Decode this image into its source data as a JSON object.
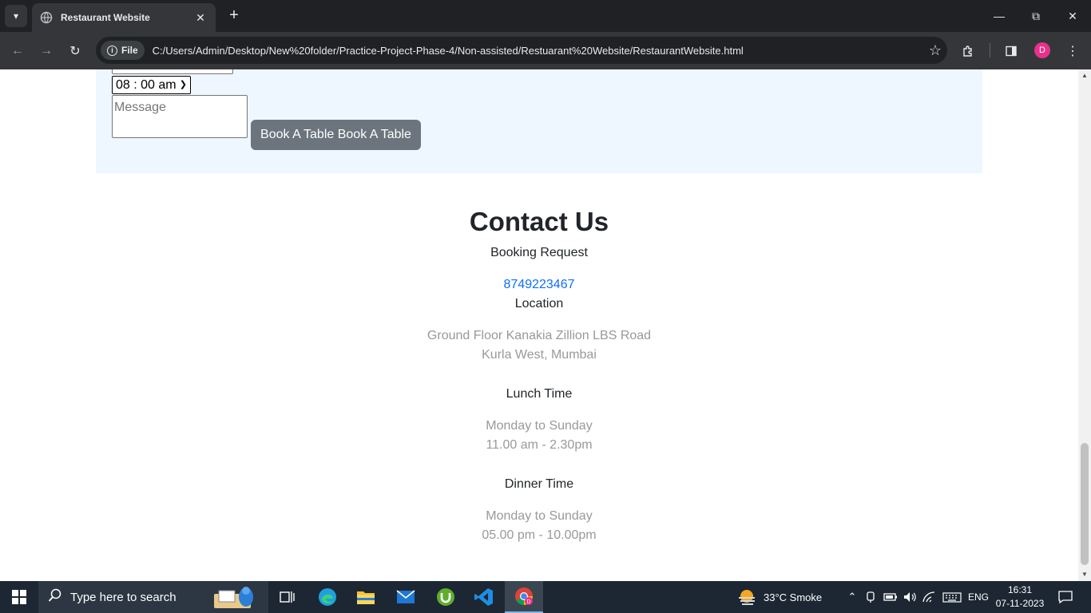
{
  "browser": {
    "tab_title": "Restaurant Website",
    "file_chip": "File",
    "url": "C:/Users/Admin/Desktop/New%20folder/Practice-Project-Phase-4/Non-assisted/Restuarant%20Website/RestaurantWebsite.html",
    "profile_initial": "D"
  },
  "booking": {
    "time_value": "08 : 00 am",
    "message_placeholder": "Message",
    "book_button": "Book A Table Book A Table"
  },
  "contact": {
    "heading": "Contact Us",
    "booking_label": "Booking Request",
    "phone": "8749223467",
    "location_label": "Location",
    "address_line1": "Ground Floor Kanakia Zillion LBS Road",
    "address_line2": "Kurla West, Mumbai",
    "lunch_label": "Lunch Time",
    "lunch_days": "Monday to Sunday",
    "lunch_hours": "11.00 am - 2.30pm",
    "dinner_label": "Dinner Time",
    "dinner_days": "Monday to Sunday",
    "dinner_hours": "05.00 pm - 10.00pm"
  },
  "taskbar": {
    "search_placeholder": "Type here to search",
    "weather": "33°C  Smoke",
    "language": "ENG",
    "time": "16:31",
    "date": "07-11-2023"
  },
  "colors": {
    "link": "#0d6efd",
    "button": "#6c757d",
    "booking_bg": "#eef6ff",
    "muted": "#999999"
  }
}
